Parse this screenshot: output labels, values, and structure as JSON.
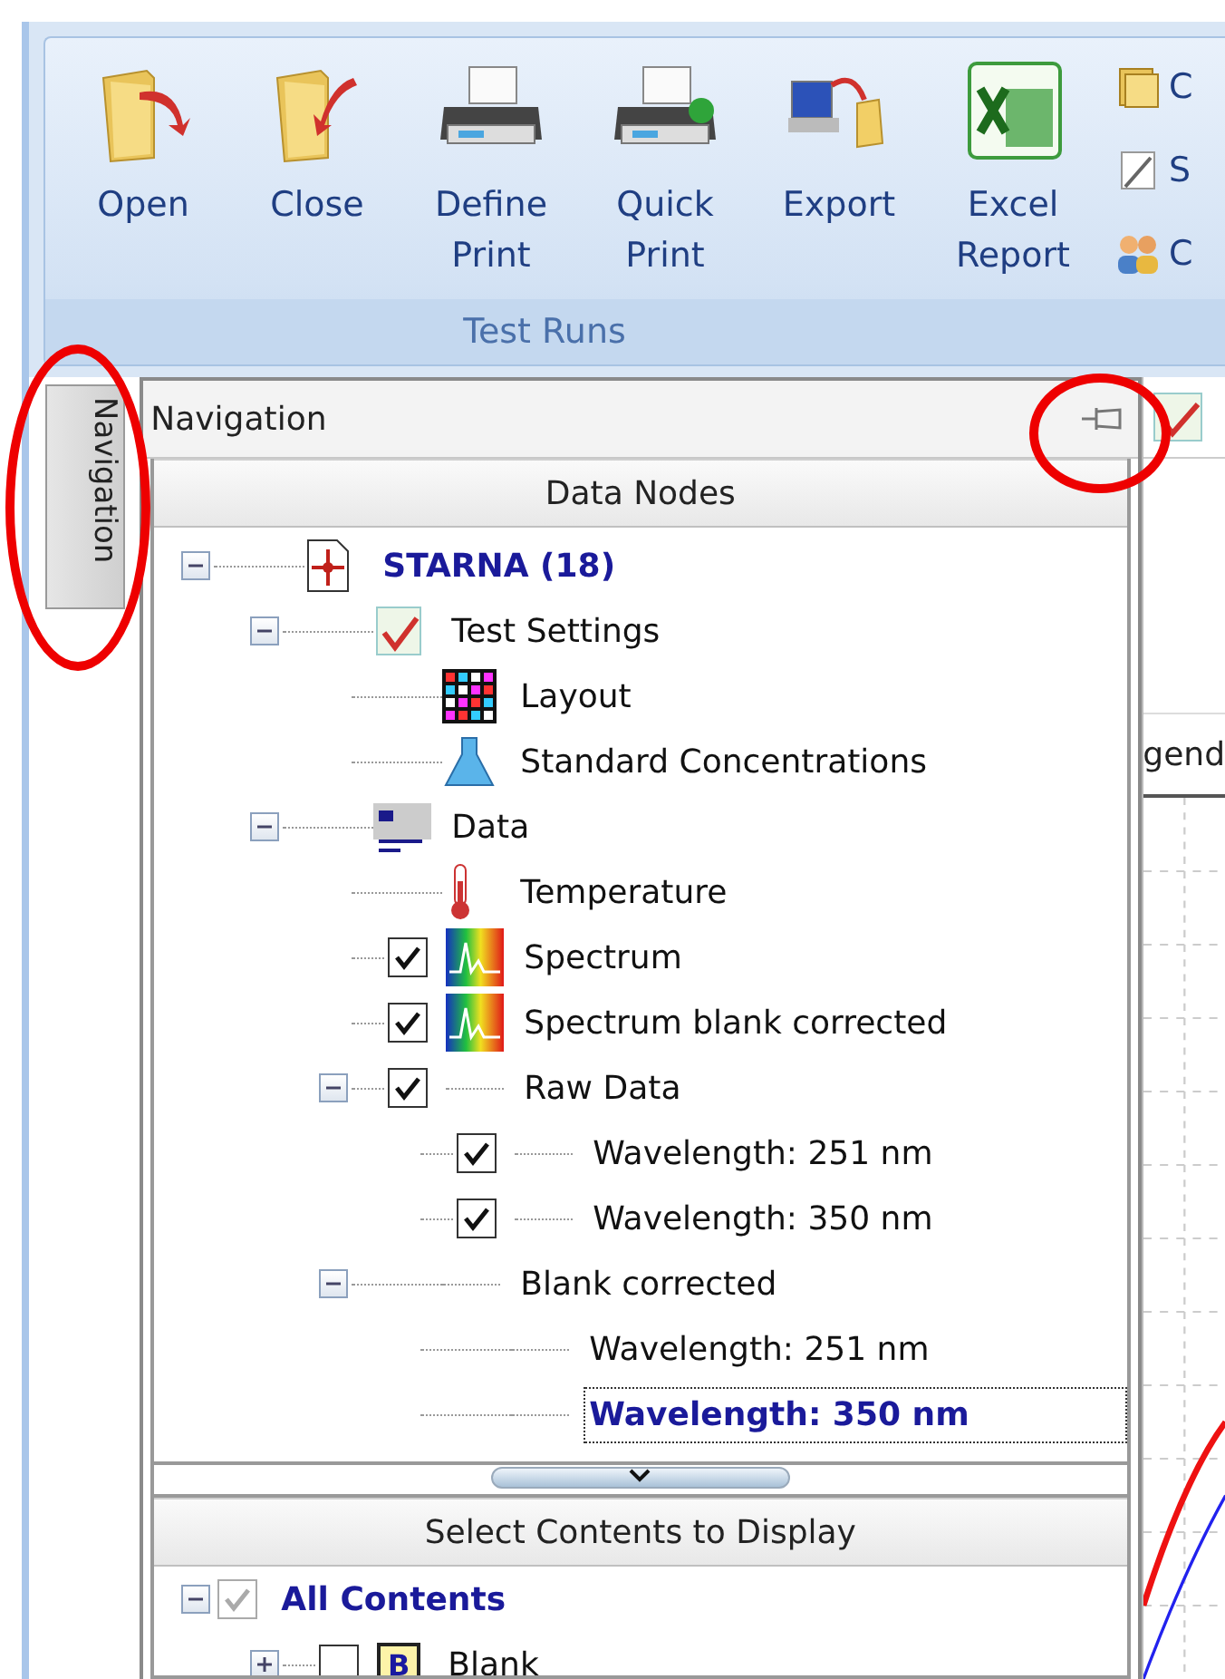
{
  "ribbon": {
    "buttons": [
      {
        "kind": "open",
        "label": "Open"
      },
      {
        "kind": "close",
        "label": "Close"
      },
      {
        "kind": "print",
        "label": "Define Print"
      },
      {
        "kind": "quick-print",
        "label": "Quick Print"
      },
      {
        "kind": "export",
        "label": "Export"
      },
      {
        "kind": "excel",
        "label": "Excel Report"
      }
    ],
    "small_items": [
      {
        "kind": "folders",
        "label": "C"
      },
      {
        "kind": "note",
        "label": "S"
      },
      {
        "kind": "people",
        "label": "C"
      }
    ],
    "group_label": "Test Runs"
  },
  "side_tab": {
    "label": "Navigation"
  },
  "navigation": {
    "title": "Navigation",
    "data_nodes": {
      "title": "Data Nodes",
      "tree": [
        {
          "label": "STARNA (18)",
          "kind": "document",
          "expanded": true,
          "selected": false,
          "children": [
            {
              "label": "Test Settings",
              "kind": "settings",
              "expanded": true,
              "selected": false,
              "children": [
                {
                  "label": "Layout",
                  "kind": "grid",
                  "selected": false
                },
                {
                  "label": "Standard Concentrations",
                  "kind": "flask",
                  "selected": false
                }
              ]
            },
            {
              "label": "Data",
              "kind": "data",
              "expanded": true,
              "selected": false,
              "children": [
                {
                  "label": "Temperature",
                  "kind": "thermometer",
                  "selected": false
                },
                {
                  "label": "Spectrum",
                  "kind": "spectrum",
                  "checked": true,
                  "selected": false
                },
                {
                  "label": "Spectrum blank corrected",
                  "kind": "spectrum",
                  "checked": true,
                  "selected": false
                },
                {
                  "label": "Raw Data",
                  "kind": "plain",
                  "checked": true,
                  "expanded": true,
                  "selected": false,
                  "children": [
                    {
                      "label": "Wavelength: 251 nm",
                      "kind": "plain",
                      "checked": true,
                      "selected": false
                    },
                    {
                      "label": "Wavelength: 350 nm",
                      "kind": "plain",
                      "checked": true,
                      "selected": false
                    }
                  ]
                },
                {
                  "label": "Blank corrected",
                  "kind": "plain",
                  "expanded": true,
                  "selected": false,
                  "children": [
                    {
                      "label": "Wavelength: 251 nm",
                      "kind": "plain",
                      "selected": false
                    },
                    {
                      "label": "Wavelength: 350 nm",
                      "kind": "plain",
                      "selected": true
                    }
                  ]
                }
              ]
            }
          ]
        }
      ]
    },
    "contents": {
      "title": "Select Contents to Display",
      "tree": [
        {
          "label": "All Contents",
          "kind": "plain",
          "checked": true,
          "disabled": true,
          "expanded": true,
          "selected": false,
          "children": [
            {
              "label": "Blank",
              "kind": "badge",
              "badge": "B",
              "checked": false,
              "disabled": false,
              "expanded": false,
              "selected": false
            }
          ]
        }
      ]
    }
  },
  "view": {
    "legend_text": "gend"
  }
}
